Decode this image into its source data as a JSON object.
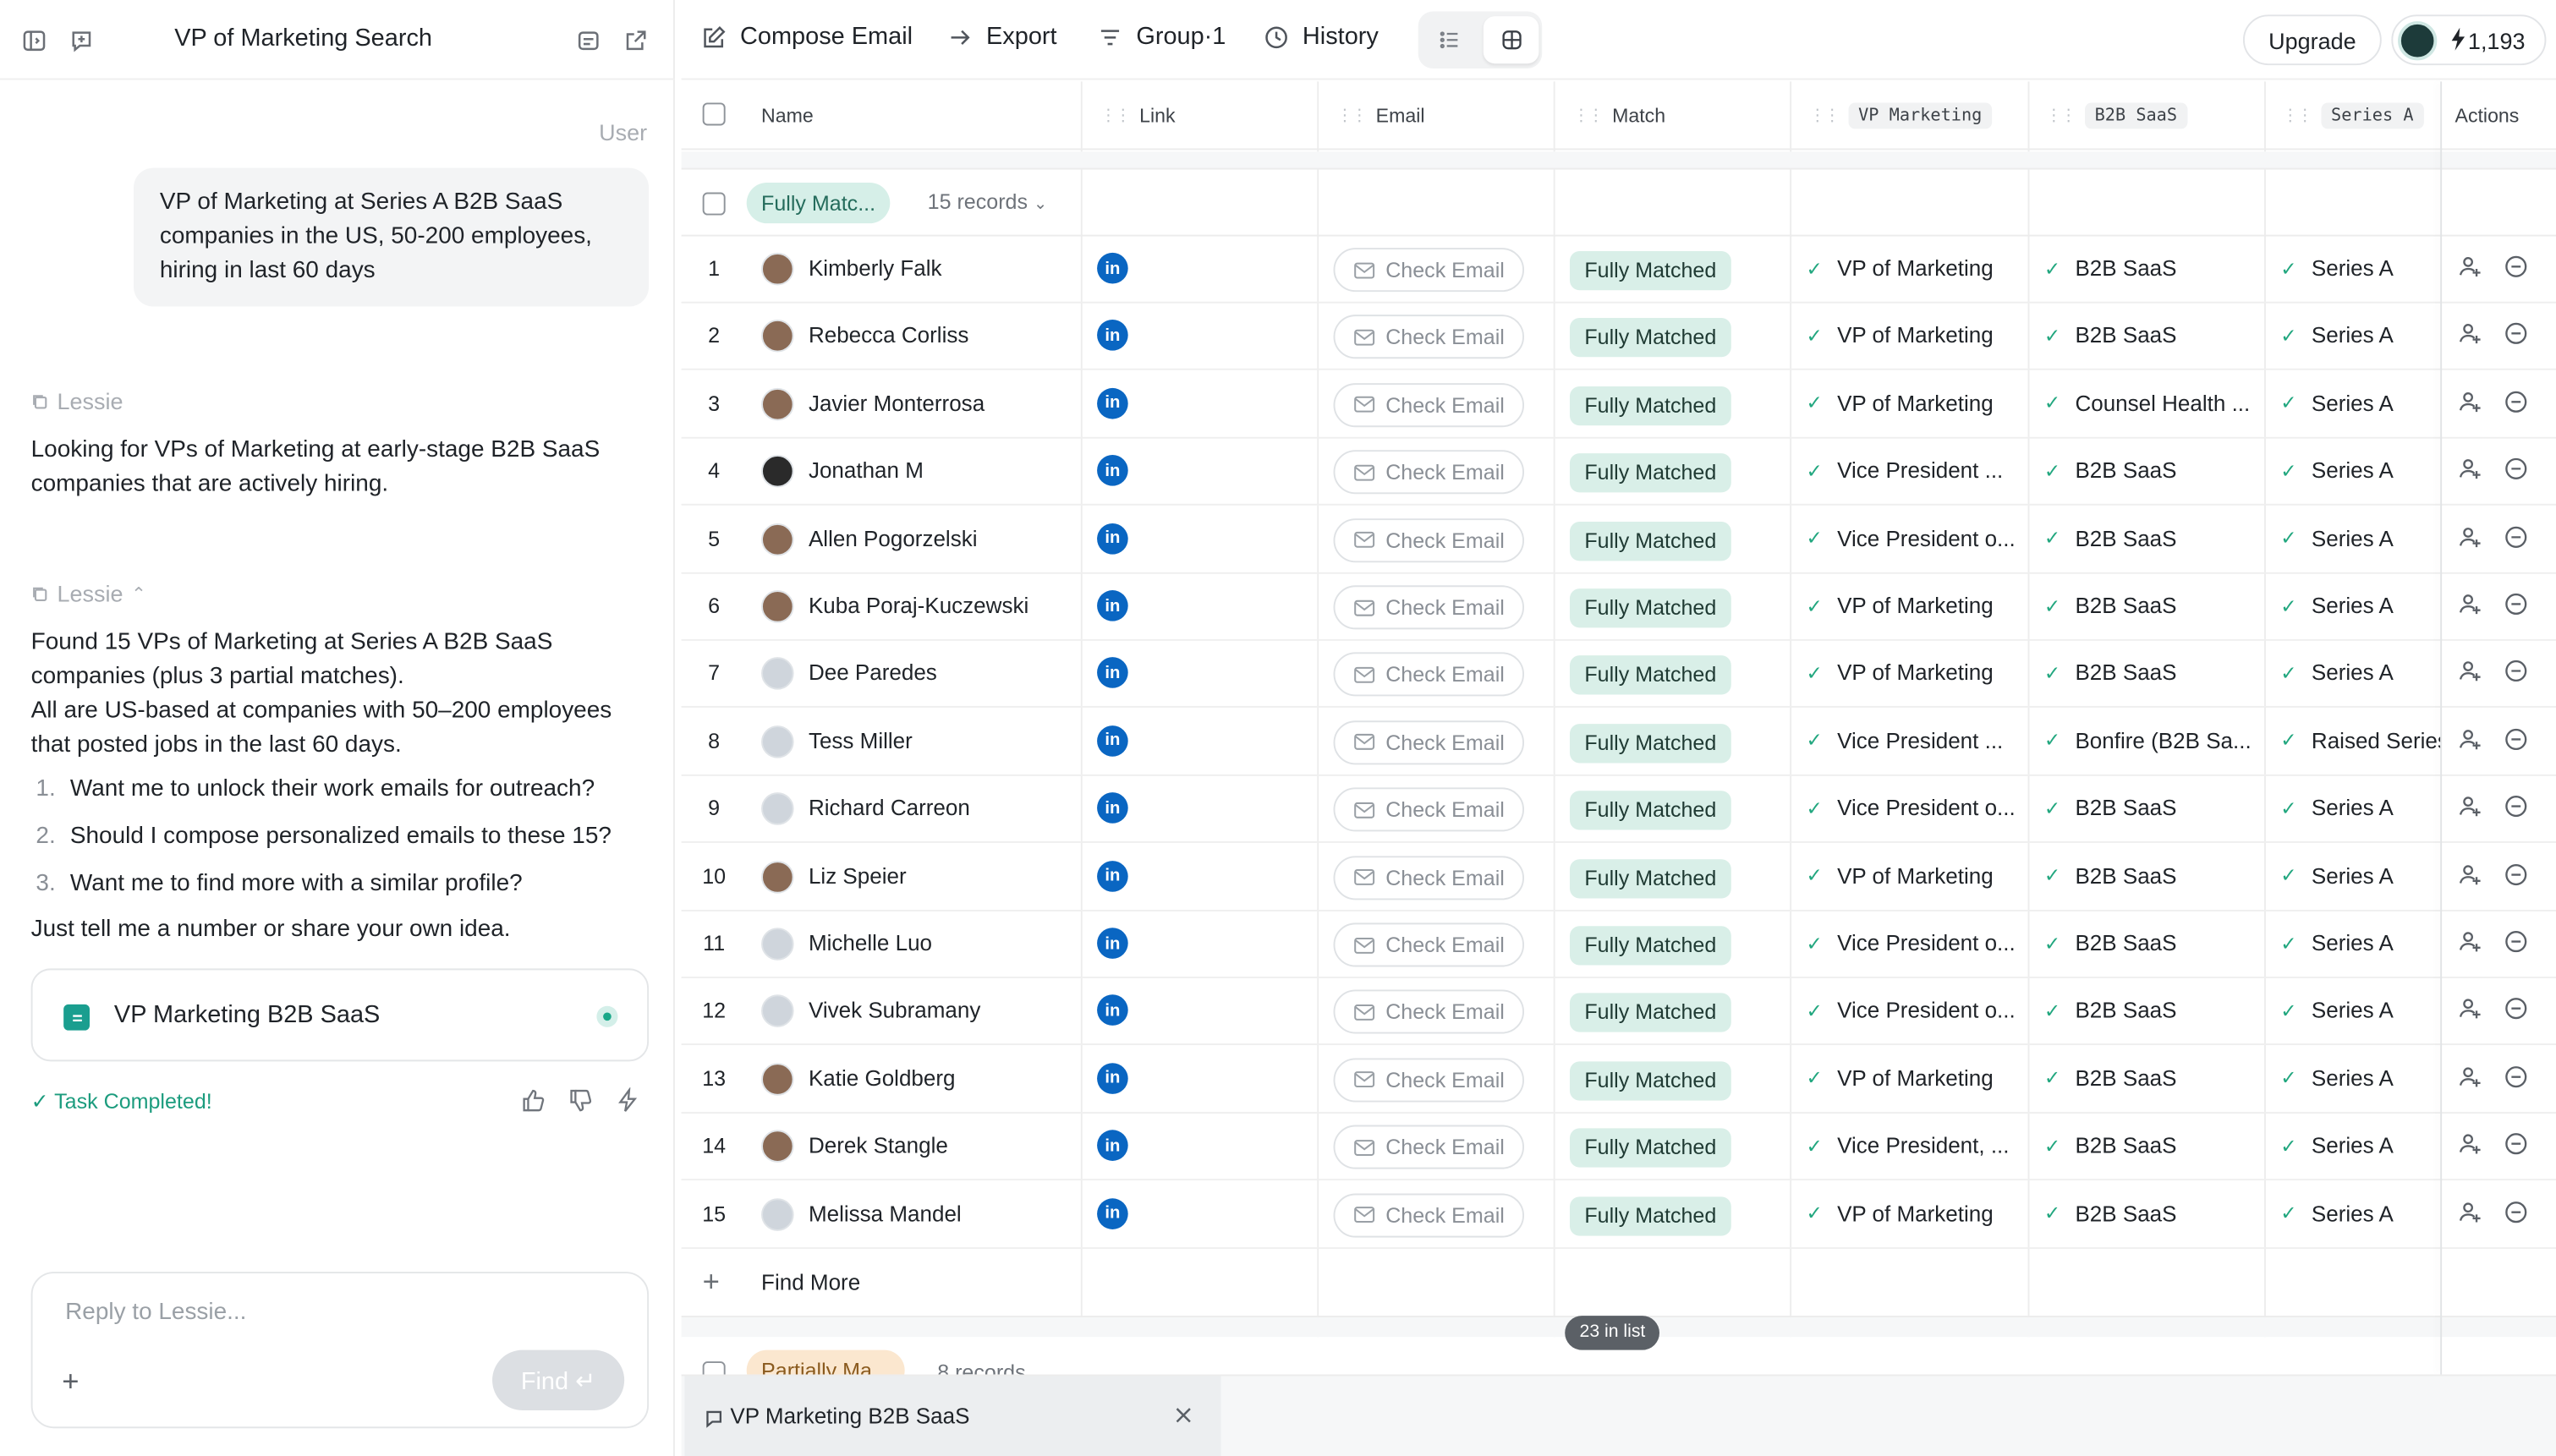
{
  "left_panel": {
    "title": "VP of Marketing Search",
    "user_label": "User",
    "user_message": "VP of Marketing at Series A B2B SaaS companies in the US, 50-200 employees, hiring in last 60 days",
    "assistant_name": "Lessie",
    "assistant_msg_1": "Looking for VPs of Marketing at early-stage B2B SaaS companies that are actively hiring.",
    "assistant_msg_2a": "Found 15 VPs of Marketing at Series A B2B SaaS companies (plus 3 partial matches).",
    "assistant_msg_2b": "All are US-based at companies with 50–200 employees that posted jobs in the last 60 days.",
    "options": [
      {
        "num": "1.",
        "text": "Want me to unlock their work emails for outreach?"
      },
      {
        "num": "2.",
        "text": "Should I compose personalized emails to these 15?"
      },
      {
        "num": "3.",
        "text": "Want me to find more with a similar profile?"
      }
    ],
    "closing": "Just tell me a number or share your own idea.",
    "task_card_label": "VP Marketing B2B SaaS",
    "task_done": "✓ Task Completed!",
    "reply_placeholder": "Reply to Lessie...",
    "find_label": "Find ↵"
  },
  "toolbar": {
    "compose": "Compose Email",
    "export": "Export",
    "group": "Group·1",
    "history": "History",
    "upgrade": "Upgrade",
    "credits": "1,193"
  },
  "table": {
    "headers": {
      "name": "Name",
      "link": "Link",
      "email": "Email",
      "match": "Match",
      "vp": "VP Marketing",
      "saas": "B2B SaaS",
      "series": "Series A",
      "actions": "Actions"
    },
    "group_label": "Fully Matc...",
    "group_count": "15 records",
    "check_email": "Check Email",
    "linkedin": "in",
    "rows": [
      {
        "idx": "1",
        "name": "Kimberly Falk",
        "match": "Fully Matched",
        "vp": "VP of Marketing",
        "saas": "B2B SaaS",
        "series": "Series A"
      },
      {
        "idx": "2",
        "name": "Rebecca Corliss",
        "match": "Fully Matched",
        "vp": "VP of Marketing",
        "saas": "B2B SaaS",
        "series": "Series A"
      },
      {
        "idx": "3",
        "name": "Javier Monterrosa",
        "match": "Fully Matched",
        "vp": "VP of Marketing",
        "saas": "Counsel Health ...",
        "series": "Series A"
      },
      {
        "idx": "4",
        "name": "Jonathan M",
        "match": "Fully Matched",
        "vp": "Vice President ...",
        "saas": "B2B SaaS",
        "series": "Series A"
      },
      {
        "idx": "5",
        "name": "Allen Pogorzelski",
        "match": "Fully Matched",
        "vp": "Vice President o...",
        "saas": "B2B SaaS",
        "series": "Series A"
      },
      {
        "idx": "6",
        "name": "Kuba Poraj-Kuczewski",
        "match": "Fully Matched",
        "vp": "VP of Marketing",
        "saas": "B2B SaaS",
        "series": "Series A"
      },
      {
        "idx": "7",
        "name": "Dee Paredes",
        "match": "Fully Matched",
        "vp": "VP of Marketing",
        "saas": "B2B SaaS",
        "series": "Series A"
      },
      {
        "idx": "8",
        "name": "Tess Miller",
        "match": "Fully Matched",
        "vp": "Vice President ...",
        "saas": "Bonfire (B2B Sa...",
        "series": "Raised Series"
      },
      {
        "idx": "9",
        "name": "Richard Carreon",
        "match": "Fully Matched",
        "vp": "Vice President o...",
        "saas": "B2B SaaS",
        "series": "Series A"
      },
      {
        "idx": "10",
        "name": "Liz Speier",
        "match": "Fully Matched",
        "vp": "VP of Marketing",
        "saas": "B2B SaaS",
        "series": "Series A"
      },
      {
        "idx": "11",
        "name": "Michelle Luo",
        "match": "Fully Matched",
        "vp": "Vice President o...",
        "saas": "B2B SaaS",
        "series": "Series A"
      },
      {
        "idx": "12",
        "name": "Vivek Subramany",
        "match": "Fully Matched",
        "vp": "Vice President o...",
        "saas": "B2B SaaS",
        "series": "Series A"
      },
      {
        "idx": "13",
        "name": "Katie Goldberg",
        "match": "Fully Matched",
        "vp": "VP of Marketing",
        "saas": "B2B SaaS",
        "series": "Series A"
      },
      {
        "idx": "14",
        "name": "Derek Stangle",
        "match": "Fully Matched",
        "vp": "Vice President, ...",
        "saas": "B2B SaaS",
        "series": "Series A"
      },
      {
        "idx": "15",
        "name": "Melissa Mandel",
        "match": "Fully Matched",
        "vp": "VP of Marketing",
        "saas": "B2B SaaS",
        "series": "Series A"
      }
    ],
    "find_more": "Find More",
    "in_list": "23 in list",
    "partial_label": "Partially Ma...",
    "partial_count": "8 records"
  },
  "bottom_tab": {
    "label": "VP Marketing B2B SaaS"
  },
  "colors": {
    "accent": "#1a9e8f",
    "match_pill": "#d9efe8",
    "partial_pill": "#fbe7cf",
    "linkedin": "#0a66c2"
  }
}
